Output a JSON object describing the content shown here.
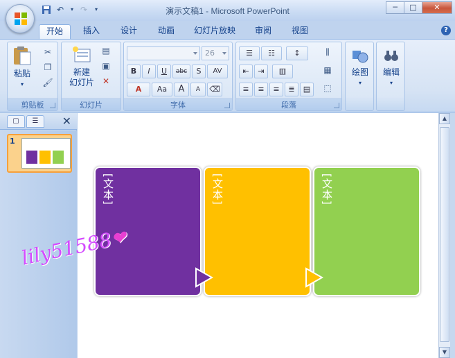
{
  "window": {
    "title": "演示文稿1 - Microsoft PowerPoint",
    "minimize": "─",
    "maximize": "□",
    "close": "✕"
  },
  "tabs": [
    "开始",
    "插入",
    "设计",
    "动画",
    "幻灯片放映",
    "审阅",
    "视图"
  ],
  "active_tab": "开始",
  "help": "?",
  "ribbon": {
    "clipboard": {
      "label": "剪贴板",
      "paste": "粘贴"
    },
    "slides": {
      "label": "幻灯片",
      "new_slide_line1": "新建",
      "new_slide_line2": "幻灯片"
    },
    "font": {
      "label": "字体",
      "font_name": "",
      "font_size": "26",
      "bold": "B",
      "italic": "I",
      "underline": "U",
      "strike": "abc",
      "shadow": "S",
      "spacing": "AV",
      "color": "A",
      "case": "Aa",
      "grow": "A",
      "shrink": "A"
    },
    "paragraph": {
      "label": "段落"
    },
    "drawing": {
      "label": "绘图"
    },
    "editing": {
      "label": "编辑"
    }
  },
  "slide_panel": {
    "slide_number": "1"
  },
  "slide": {
    "cards": [
      {
        "text": "[文本]",
        "color": "#7030a0"
      },
      {
        "text": "[文本]",
        "color": "#ffc000"
      },
      {
        "text": "[文本]",
        "color": "#92d050"
      }
    ]
  },
  "watermark": "lily51588"
}
